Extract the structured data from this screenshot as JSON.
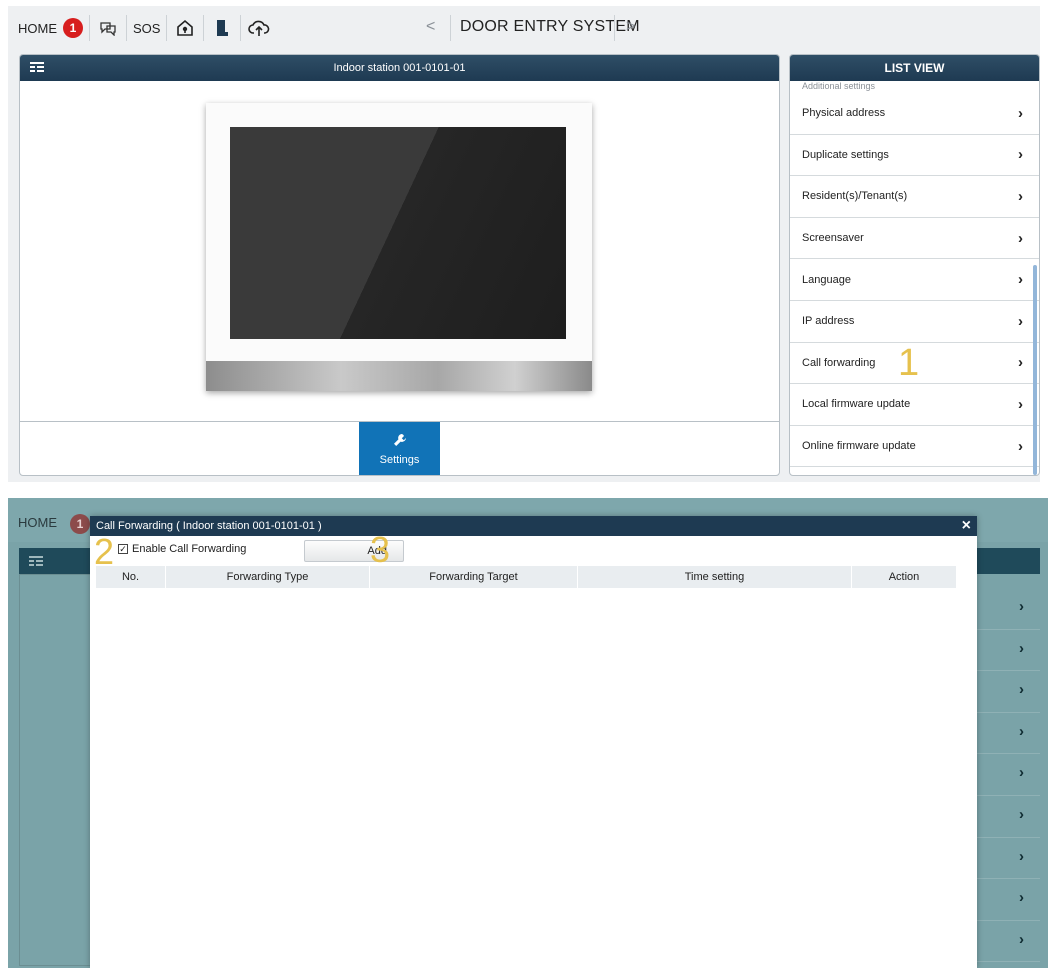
{
  "topbar": {
    "home_label": "HOME",
    "notification_count": "1",
    "sos_label": "SOS",
    "title": "DOOR ENTRY SYSTEM",
    "prev_label": "<",
    "next_label": ">"
  },
  "station": {
    "title": "Indoor station 001-0101-01",
    "settings_label": "Settings"
  },
  "listview": {
    "title": "LIST VIEW",
    "group_label": "Additional settings",
    "items": [
      {
        "label": "Physical address"
      },
      {
        "label": "Duplicate settings"
      },
      {
        "label": "Resident(s)/Tenant(s)"
      },
      {
        "label": "Screensaver"
      },
      {
        "label": "Language"
      },
      {
        "label": "IP address"
      },
      {
        "label": "Call forwarding",
        "marker": "1"
      },
      {
        "label": "Local firmware update"
      },
      {
        "label": "Online firmware update"
      }
    ]
  },
  "dialog": {
    "title": "Call Forwarding ( Indoor station 001-0101-01 )",
    "close_label": "×",
    "enable_label": "Enable Call Forwarding",
    "enable_checked": true,
    "add_label": "Add",
    "marker_enable": "2",
    "marker_add": "3",
    "columns": [
      "No.",
      "Forwarding Type",
      "Forwarding Target",
      "Time setting",
      "Action"
    ]
  },
  "background": {
    "home_label": "HOME",
    "notification_count": "1"
  },
  "colors": {
    "header_navy": "#1e3a52",
    "accent_blue": "#1173b7",
    "badge_red": "#d71e1e",
    "annotation_gold": "#e6c14d",
    "overlay_teal": "#7aa3a8"
  }
}
